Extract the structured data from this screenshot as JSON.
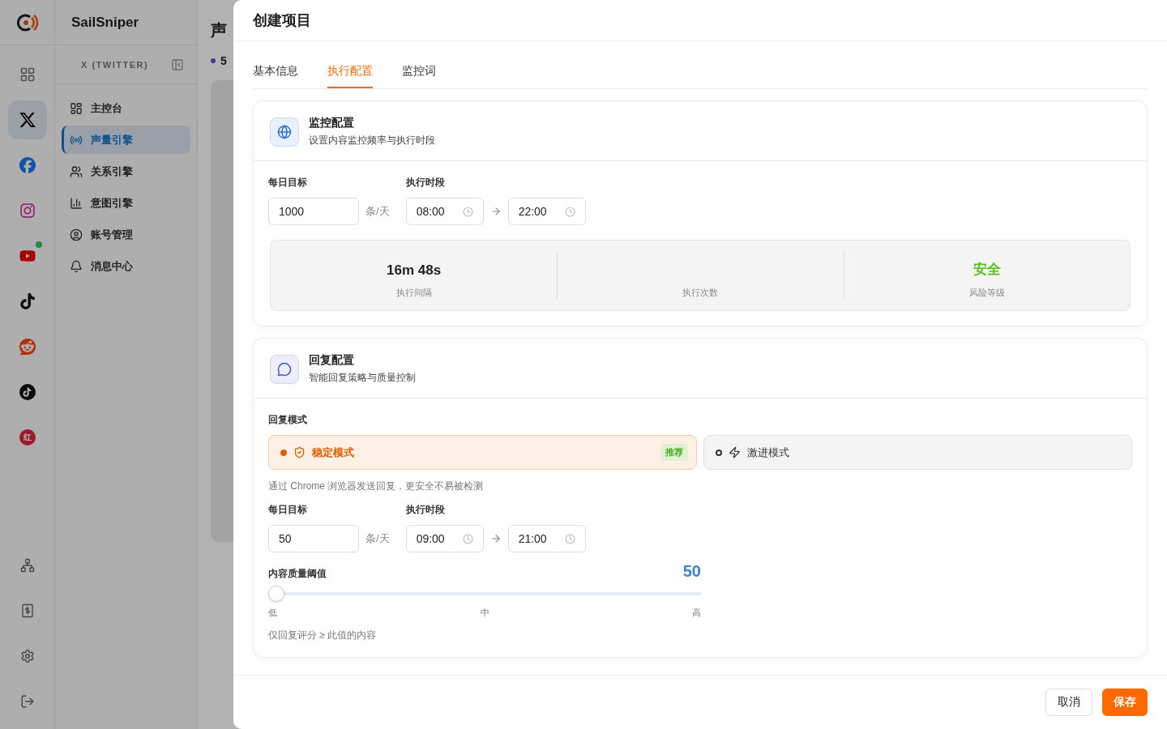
{
  "app": {
    "name": "SailSniper"
  },
  "rail": {
    "platforms": [
      {
        "kind": "x",
        "selected": true,
        "notify": false
      },
      {
        "kind": "facebook",
        "selected": false,
        "notify": false
      },
      {
        "kind": "instagram",
        "selected": false,
        "notify": false
      },
      {
        "kind": "youtube",
        "selected": false,
        "notify": true
      },
      {
        "kind": "tiktok",
        "selected": false,
        "notify": false
      },
      {
        "kind": "reddit",
        "selected": false,
        "notify": false
      },
      {
        "kind": "tiktok-round",
        "selected": false,
        "notify": false
      },
      {
        "kind": "xiaohongshu",
        "selected": false,
        "notify": false,
        "logo_text": "红"
      }
    ]
  },
  "nav": {
    "platform_label": "X (TWITTER)",
    "items": [
      {
        "label": "主控台",
        "kind": "dashboard",
        "selected": false
      },
      {
        "label": "声量引擎",
        "kind": "radio",
        "selected": true
      },
      {
        "label": "关系引擎",
        "kind": "users",
        "selected": false
      },
      {
        "label": "意图引擎",
        "kind": "chart",
        "selected": false
      },
      {
        "label": "账号管理",
        "kind": "account",
        "selected": false
      },
      {
        "label": "消息中心",
        "kind": "bell",
        "selected": false
      }
    ]
  },
  "page": {
    "title": "声",
    "stat": "5"
  },
  "drawer": {
    "title": "创建项目",
    "tabs": [
      {
        "label": "基本信息",
        "selected": false
      },
      {
        "label": "执行配置",
        "selected": true
      },
      {
        "label": "监控词",
        "selected": false
      }
    ],
    "monitor": {
      "title": "监控配置",
      "subtitle": "设置内容监控频率与执行时段",
      "target": {
        "label": "每日目标",
        "value": "1000",
        "unit": "条/天"
      },
      "schedule": {
        "label": "执行时段",
        "start": "08:00",
        "end": "22:00"
      },
      "stats": [
        {
          "value": "16m 48s",
          "label": "执行间隔",
          "color": "#1f1f1f"
        },
        {
          "label": "执行次数"
        },
        {
          "value": "安全",
          "label": "风险等级",
          "color": "#52c41a"
        }
      ]
    },
    "reply": {
      "title": "回复配置",
      "subtitle": "智能回复策略与质量控制",
      "mode_label": "回复模式",
      "modes": [
        {
          "label": "稳定模式",
          "kind": "shield",
          "selected": true,
          "badge": "推荐"
        },
        {
          "label": "激进模式",
          "kind": "bolt",
          "selected": false
        }
      ],
      "hint": "通过 Chrome 浏览器发送回复，更安全不易被检测",
      "target": {
        "label": "每日目标",
        "value": "50",
        "unit": "条/天"
      },
      "schedule": {
        "label": "执行时段",
        "start": "09:00",
        "end": "21:00"
      },
      "threshold": {
        "label": "内容质量阈值",
        "reading": "50",
        "level": 0,
        "ticks": [
          "低",
          "中",
          "高"
        ],
        "hint": "仅回复评分 ≥ 此值的内容"
      }
    },
    "buttons": [
      {
        "label": "取消",
        "kind": "secondary"
      },
      {
        "label": "保存",
        "kind": "primary"
      }
    ]
  }
}
